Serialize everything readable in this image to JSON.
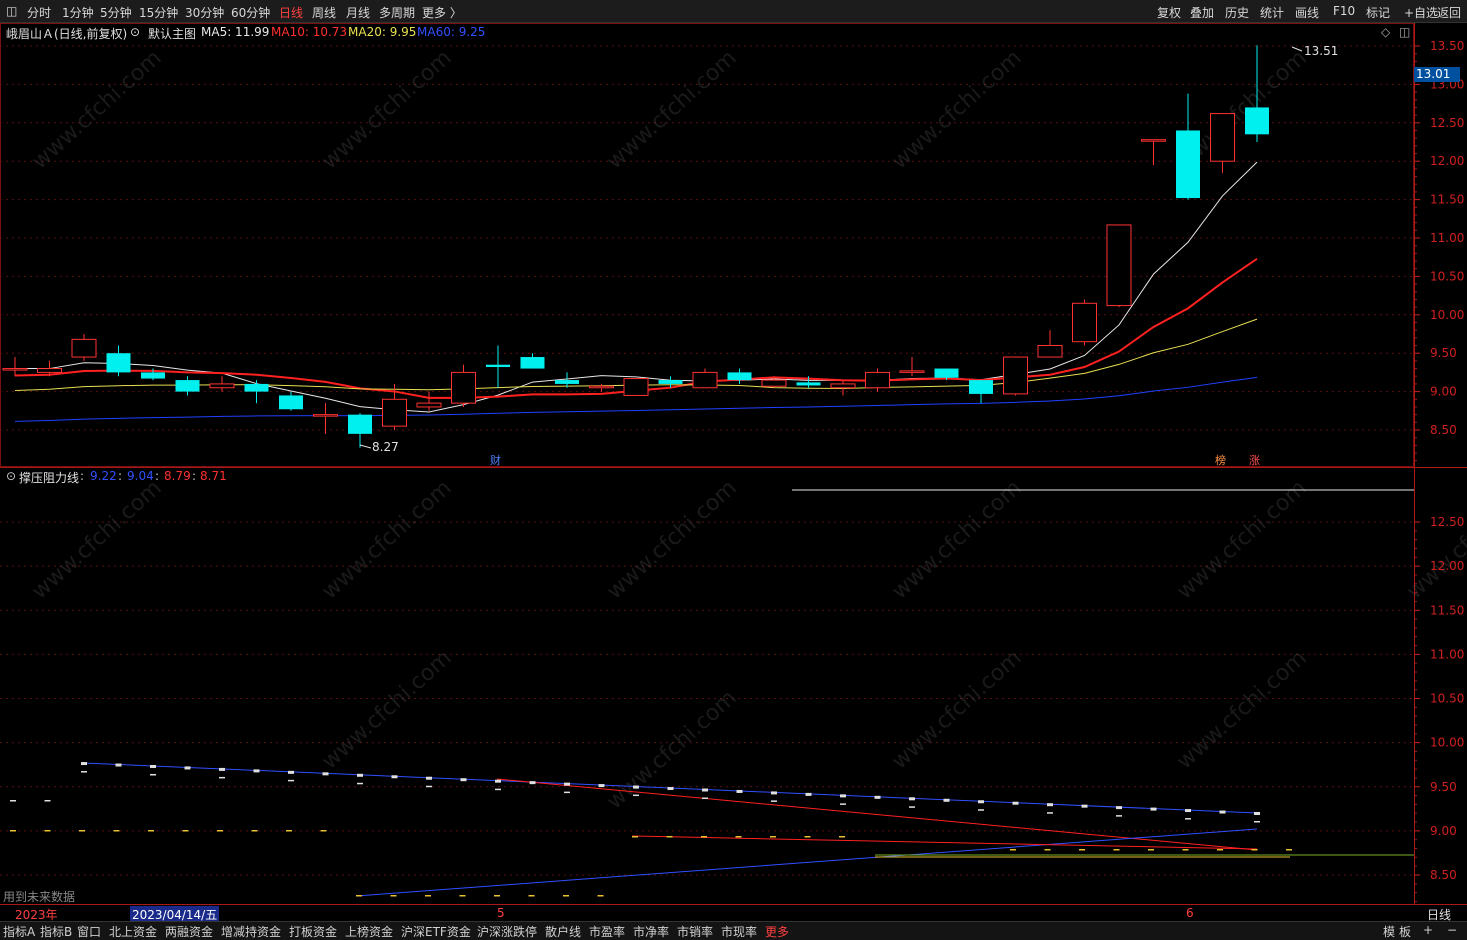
{
  "toolbar": {
    "periods": [
      "分时",
      "1分钟",
      "5分钟",
      "15分钟",
      "30分钟",
      "60分钟",
      "日线",
      "周线",
      "月线",
      "多周期",
      "更多 〉"
    ],
    "active_period": "日线",
    "right": [
      "复权",
      "叠加",
      "历史",
      "统计",
      "画线",
      "F10",
      "标记",
      "+自选",
      "返回"
    ]
  },
  "main": {
    "stock_title": "峨眉山Ａ(日线,前复权)",
    "template_label": "默认主图",
    "ma": [
      {
        "label": "MA5: 11.99",
        "color": "#e8e8e8"
      },
      {
        "label": "MA10: 10.73",
        "color": "#ff3030"
      },
      {
        "label": "MA20: 9.95",
        "color": "#e8e050"
      },
      {
        "label": "MA60: 9.25",
        "color": "#3050ff"
      }
    ],
    "price_axis": [
      "13.50",
      "13.00",
      "12.50",
      "12.00",
      "11.50",
      "11.00",
      "10.50",
      "10.00",
      "9.50",
      "9.00",
      "8.50"
    ],
    "current_price": "13.01",
    "high_label": "13.51",
    "low_label": "8.27",
    "markers": [
      {
        "text": "财",
        "color": "#5080ff"
      },
      {
        "text": "榜",
        "color": "#ff9040"
      },
      {
        "text": "涨",
        "color": "#ff5050"
      }
    ]
  },
  "sub": {
    "name": "撑压阻力线",
    "values": [
      {
        "text": "9.22",
        "color": "#3050ff"
      },
      {
        "text": "9.04",
        "color": "#3050ff"
      },
      {
        "text": "8.79",
        "color": "#ff3030"
      },
      {
        "text": "8.71",
        "color": "#ff3030"
      }
    ],
    "axis": [
      "12.50",
      "12.00",
      "11.50",
      "11.00",
      "10.50",
      "10.00",
      "9.50",
      "9.00",
      "8.50"
    ],
    "future_note": "用到未来数据"
  },
  "datebar": {
    "year": "2023年",
    "cursor_date": "2023/04/14/五",
    "m5": "5",
    "m6": "6",
    "period": "日线"
  },
  "bottom_tabs": [
    "指标A",
    "指标B",
    "窗口",
    "北上资金",
    "两融资金",
    "增减持资金",
    "打板资金",
    "上榜资金",
    "沪深ETF资金",
    "沪深涨跌停",
    "散户线",
    "市盈率",
    "市净率",
    "市销率",
    "市现率",
    "更多"
  ],
  "bottom_right": [
    "模",
    "板",
    "+",
    "−"
  ],
  "watermark": "www.cfchi.com",
  "chart_data": {
    "type": "candlestick",
    "candles": [
      {
        "o": 9.3,
        "h": 9.45,
        "l": 9.2,
        "c": 9.3
      },
      {
        "o": 9.25,
        "h": 9.4,
        "l": 9.2,
        "c": 9.3
      },
      {
        "o": 9.45,
        "h": 9.75,
        "l": 9.4,
        "c": 9.68
      },
      {
        "o": 9.5,
        "h": 9.6,
        "l": 9.2,
        "c": 9.25
      },
      {
        "o": 9.25,
        "h": 9.3,
        "l": 9.15,
        "c": 9.17
      },
      {
        "o": 9.15,
        "h": 9.2,
        "l": 8.95,
        "c": 9.0
      },
      {
        "o": 9.05,
        "h": 9.2,
        "l": 9.0,
        "c": 9.1
      },
      {
        "o": 9.1,
        "h": 9.15,
        "l": 8.85,
        "c": 9.0
      },
      {
        "o": 8.95,
        "h": 9.0,
        "l": 8.75,
        "c": 8.77
      },
      {
        "o": 8.7,
        "h": 8.85,
        "l": 8.45,
        "c": 8.7
      },
      {
        "o": 8.7,
        "h": 8.72,
        "l": 8.27,
        "c": 8.45
      },
      {
        "o": 8.55,
        "h": 9.1,
        "l": 8.5,
        "c": 8.9
      },
      {
        "o": 8.8,
        "h": 9.0,
        "l": 8.75,
        "c": 8.85
      },
      {
        "o": 8.85,
        "h": 9.35,
        "l": 8.8,
        "c": 9.25
      },
      {
        "o": 9.35,
        "h": 9.6,
        "l": 9.05,
        "c": 9.32
      },
      {
        "o": 9.45,
        "h": 9.5,
        "l": 9.3,
        "c": 9.3
      },
      {
        "o": 9.15,
        "h": 9.25,
        "l": 9.05,
        "c": 9.1
      },
      {
        "o": 9.05,
        "h": 9.1,
        "l": 9.0,
        "c": 9.07
      },
      {
        "o": 8.95,
        "h": 9.05,
        "l": 8.95,
        "c": 9.17
      },
      {
        "o": 9.15,
        "h": 9.2,
        "l": 9.05,
        "c": 9.1
      },
      {
        "o": 9.05,
        "h": 9.3,
        "l": 9.05,
        "c": 9.25
      },
      {
        "o": 9.25,
        "h": 9.3,
        "l": 9.1,
        "c": 9.15
      },
      {
        "o": 9.07,
        "h": 9.2,
        "l": 9.05,
        "c": 9.15
      },
      {
        "o": 9.12,
        "h": 9.2,
        "l": 9.05,
        "c": 9.08
      },
      {
        "o": 9.05,
        "h": 9.15,
        "l": 8.95,
        "c": 9.1
      },
      {
        "o": 9.05,
        "h": 9.3,
        "l": 9.0,
        "c": 9.25
      },
      {
        "o": 9.27,
        "h": 9.45,
        "l": 9.2,
        "c": 9.27
      },
      {
        "o": 9.3,
        "h": 9.3,
        "l": 9.15,
        "c": 9.18
      },
      {
        "o": 9.15,
        "h": 9.15,
        "l": 8.85,
        "c": 8.97
      },
      {
        "o": 8.97,
        "h": 9.45,
        "l": 8.95,
        "c": 9.45
      },
      {
        "o": 9.45,
        "h": 9.8,
        "l": 9.45,
        "c": 9.6
      },
      {
        "o": 9.65,
        "h": 10.2,
        "l": 9.6,
        "c": 10.15
      },
      {
        "o": 10.12,
        "h": 11.17,
        "l": 10.1,
        "c": 11.17
      },
      {
        "o": 12.28,
        "h": 12.28,
        "l": 11.95,
        "c": 12.28
      },
      {
        "o": 12.4,
        "h": 12.88,
        "l": 11.5,
        "c": 11.52
      },
      {
        "o": 12.0,
        "h": 12.62,
        "l": 11.85,
        "c": 12.62
      },
      {
        "o": 12.7,
        "h": 13.51,
        "l": 12.25,
        "c": 12.35
      }
    ],
    "ma_latest": {
      "MA5": 11.99,
      "MA10": 10.73,
      "MA20": 9.95,
      "MA60": 9.25
    },
    "y_range": [
      8.2,
      13.7
    ]
  }
}
